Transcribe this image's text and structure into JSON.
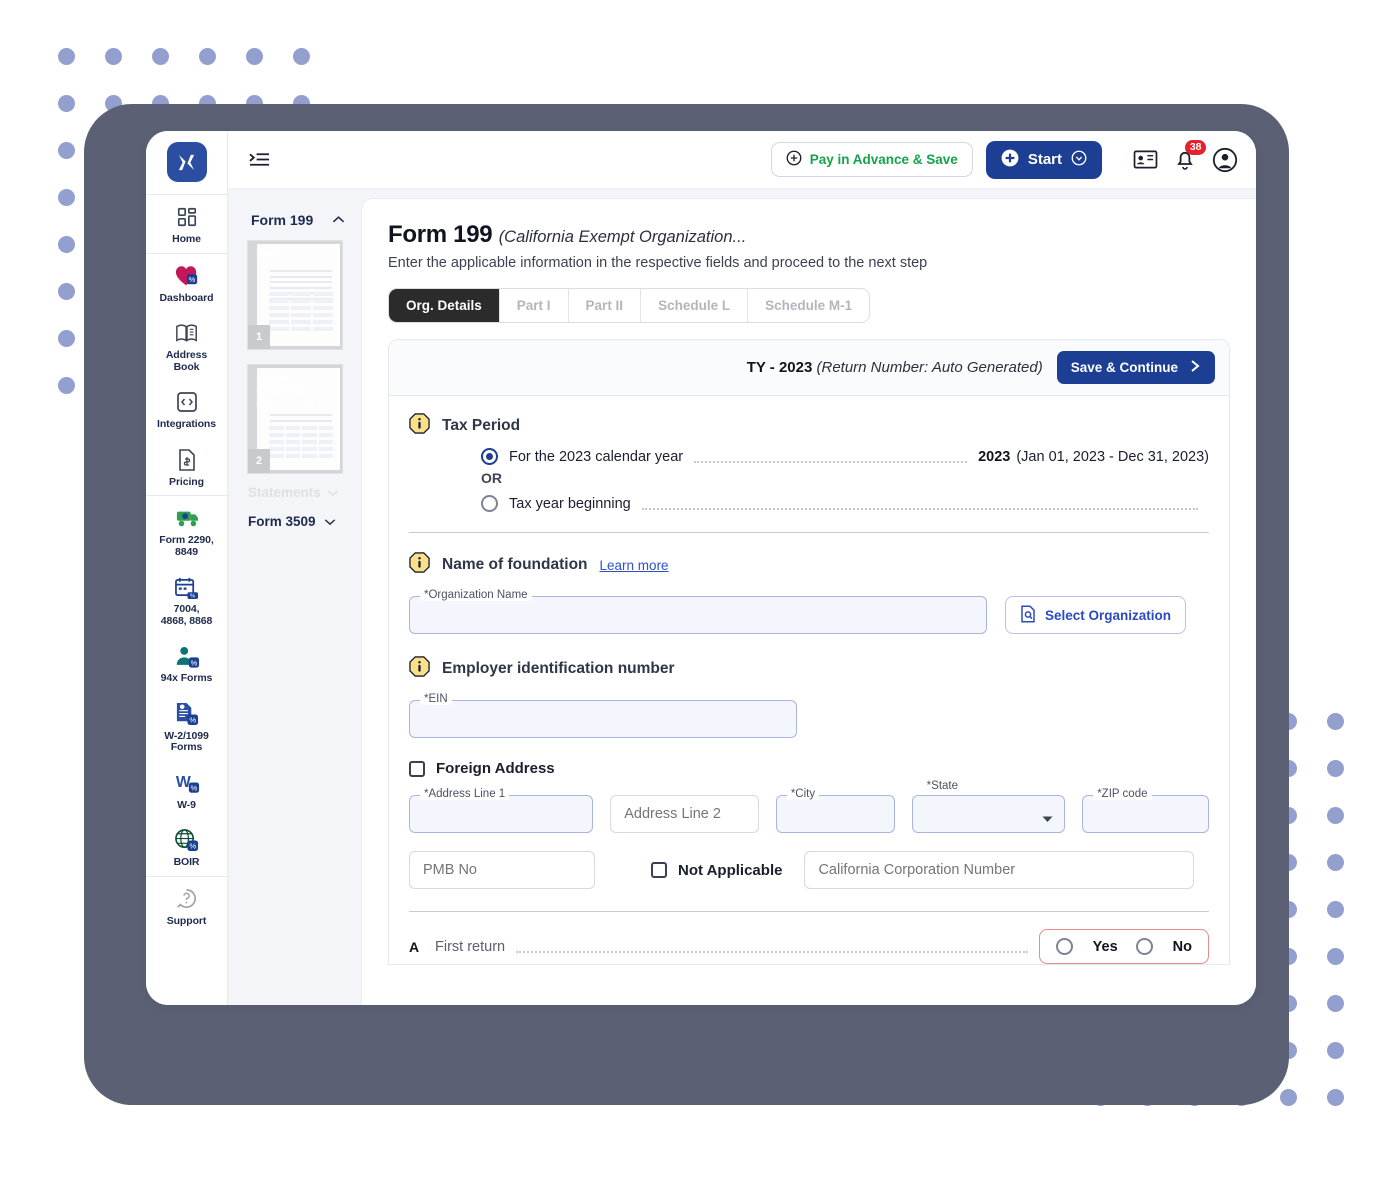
{
  "brand": {
    "logo_name": "x-logo",
    "accent": "#1c3f94",
    "frame_color": "#5b6075",
    "dot_color": "#93a0cf"
  },
  "topbar": {
    "collapse_icon": "collapse-sidebar-icon",
    "pay_label": "Pay in Advance & Save",
    "pay_icon": "plus-circle-icon",
    "start_label": "Start",
    "start_icon": "plus-circle-icon",
    "start_caret_icon": "chevron-down-circle-icon",
    "contact_icon": "contact-card-icon",
    "bell_icon": "bell-icon",
    "badge_count": "38",
    "avatar_icon": "user-avatar-icon"
  },
  "rail": {
    "items": [
      {
        "label": "Home",
        "icon": "grid-dashboard-icon"
      },
      {
        "label": "Dashboard",
        "icon": "heart-tax-icon"
      },
      {
        "label": "Address\nBook",
        "label_l1": "Address",
        "label_l2": "Book",
        "icon": "address-book-icon"
      },
      {
        "label": "Integrations",
        "icon": "code-brackets-icon"
      },
      {
        "label": "Pricing",
        "icon": "dollar-document-icon"
      },
      {
        "label_l1": "Form 2290,",
        "label_l2": "8849",
        "icon": "truck-icon"
      },
      {
        "label_l1": "7004,",
        "label_l2": "4868, 8868",
        "icon": "calendar-icon"
      },
      {
        "label_l1": "94x Forms",
        "label_l2": "",
        "icon": "person-tax-icon"
      },
      {
        "label_l1": "W-2/1099",
        "label_l2": "Forms",
        "icon": "document-tax-icon"
      },
      {
        "label_l1": "W-9",
        "label_l2": "",
        "icon": "w9-icon"
      },
      {
        "label_l1": "BOIR",
        "label_l2": "",
        "icon": "globe-icon"
      },
      {
        "label_l1": "Support",
        "label_l2": "",
        "icon": "help-circle-icon"
      }
    ]
  },
  "navpanel": {
    "title": "Form 199",
    "collapse_icon": "chevron-up-icon",
    "thumbnails": [
      {
        "page": "1",
        "labels": [
          "Part I"
        ]
      },
      {
        "page": "2",
        "labels": [
          "Part II",
          "Schedule L",
          "Schedule M-1"
        ]
      }
    ],
    "statements_label": "Statements",
    "statements_caret": "chevron-down-icon",
    "form3509_label": "Form 3509",
    "form3509_caret": "chevron-down-icon"
  },
  "main": {
    "title": "Form 199",
    "title_sub": "(California Exempt Organization...",
    "description": "Enter the applicable information in the respective fields and proceed to the next step",
    "tabs": [
      {
        "label": "Org. Details",
        "active": true
      },
      {
        "label": "Part I",
        "active": false
      },
      {
        "label": "Part II",
        "active": false
      },
      {
        "label": "Schedule L",
        "active": false
      },
      {
        "label": "Schedule M-1",
        "active": false
      }
    ],
    "header_bar": {
      "ty_label": "TY - 2023",
      "return_number": "(Return Number: Auto Generated)",
      "save_continue_label": "Save & Continue",
      "save_continue_icon": "chevron-right-icon"
    },
    "tax_period": {
      "info_icon": "info-icon",
      "title": "Tax Period",
      "option1_label": "For the 2023 calendar year",
      "option1_selected": true,
      "option1_year": "2023",
      "option1_range": "(Jan 01, 2023 - Dec 31, 2023)",
      "or_label": "OR",
      "option2_label": "Tax year beginning",
      "option2_selected": false
    },
    "foundation": {
      "info_icon": "info-icon",
      "title": "Name of foundation",
      "learn_more": "Learn more",
      "org_name_legend": "*Organization Name",
      "org_name_value": "",
      "select_org_label": "Select Organization",
      "select_org_icon": "document-search-icon"
    },
    "ein": {
      "info_icon": "info-icon",
      "title": "Employer identification number",
      "legend": "*EIN",
      "value": ""
    },
    "address": {
      "foreign_checkbox_label": "Foreign Address",
      "foreign_checked": false,
      "address1_legend": "*Address Line 1",
      "address1_value": "",
      "address2_placeholder": "Address Line 2",
      "city_legend": "*City",
      "city_value": "",
      "state_legend": "*State",
      "state_value": "",
      "state_caret_icon": "caret-down-icon",
      "zip_legend": "*ZIP code",
      "zip_value": "",
      "pmb_placeholder": "PMB No",
      "not_applicable_label": "Not Applicable",
      "not_applicable_checked": false,
      "ca_corp_placeholder": "California Corporation Number"
    },
    "question_a": {
      "letter": "A",
      "text": "First return",
      "yes_label": "Yes",
      "no_label": "No",
      "selected": ""
    }
  }
}
